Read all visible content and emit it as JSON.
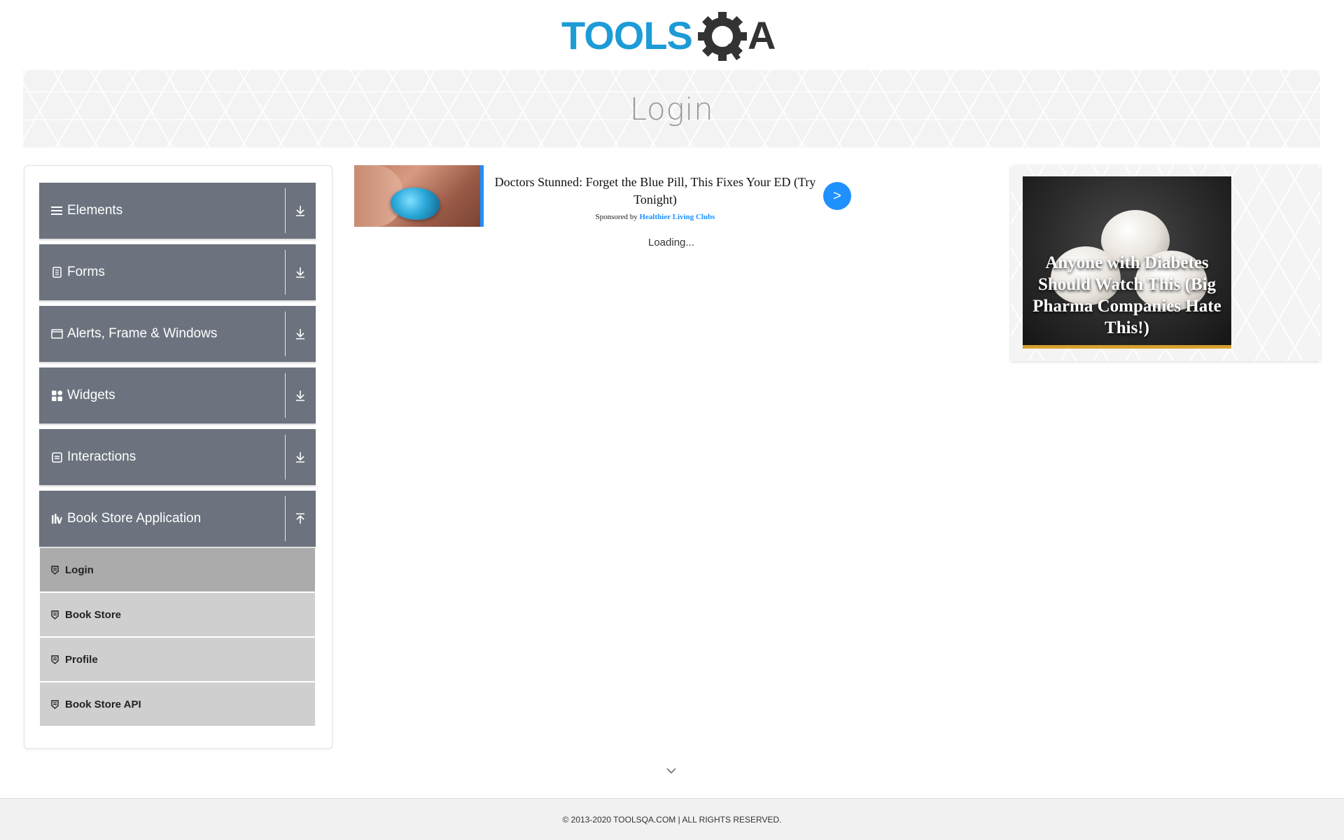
{
  "header": {
    "logo_text_left": "TOOLS",
    "logo_text_right": "QA",
    "brand_blue": "#1d9bd7",
    "brand_dark": "#333333"
  },
  "banner": {
    "title": "Login"
  },
  "sidebar": {
    "groups": [
      {
        "label": "Elements",
        "icon": "hamburger-icon",
        "expanded": false
      },
      {
        "label": "Forms",
        "icon": "document-icon",
        "expanded": false
      },
      {
        "label": "Alerts, Frame & Windows",
        "icon": "window-icon",
        "expanded": false
      },
      {
        "label": "Widgets",
        "icon": "widgets-grid-icon",
        "expanded": false
      },
      {
        "label": "Interactions",
        "icon": "interaction-icon",
        "expanded": false
      },
      {
        "label": "Book Store Application",
        "icon": "books-icon",
        "expanded": true
      }
    ],
    "book_store_items": [
      {
        "label": "Login",
        "active": true
      },
      {
        "label": "Book Store",
        "active": false
      },
      {
        "label": "Profile",
        "active": false
      },
      {
        "label": "Book Store API",
        "active": false
      }
    ],
    "colors": {
      "group_bg": "#6c737e",
      "item_bg": "#cfcfcf",
      "active_item_bg": "#ababab"
    }
  },
  "ad_native": {
    "headline": "Doctors Stunned: Forget the Blue Pill, This Fixes Your ED (Try Tonight)",
    "sponsored_prefix": "Sponsored by",
    "sponsor": "Healthier Living Clubs",
    "arrow": ">",
    "accent_color": "#1e90ff"
  },
  "loading_text": "Loading...",
  "ad_right": {
    "caption": "Anyone with Diabetes Should Watch This (Big Pharma Companies Hate This!)"
  },
  "footer": {
    "text": "© 2013-2020 TOOLSQA.COM | ALL RIGHTS RESERVED."
  }
}
